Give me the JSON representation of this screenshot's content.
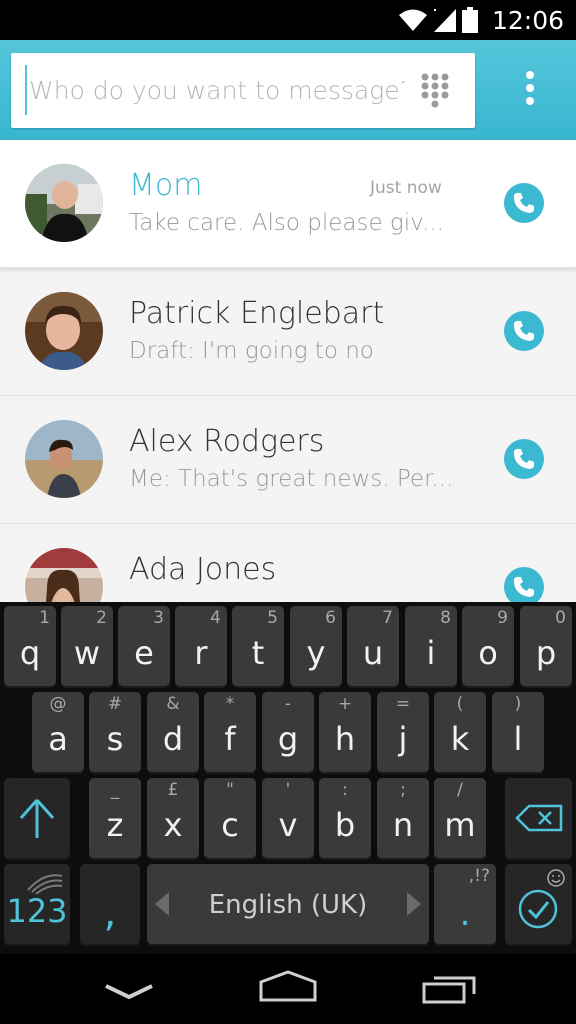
{
  "status_bar": {
    "time": "12:06"
  },
  "search": {
    "placeholder": "Who do you want to message?",
    "value": ""
  },
  "conversations": [
    {
      "name": "Mom",
      "snippet": "Take care. Also please giv...",
      "time": "Just now",
      "selected": true
    },
    {
      "name": "Patrick Englebart",
      "snippet": "Draft: I'm going to no",
      "time": ""
    },
    {
      "name": "Alex Rodgers",
      "snippet": "Me: That's great news.  Per...",
      "time": ""
    },
    {
      "name": "Ada Jones",
      "snippet": "",
      "time": ""
    }
  ],
  "keyboard": {
    "row1": [
      {
        "k": "q",
        "s": "1"
      },
      {
        "k": "w",
        "s": "2"
      },
      {
        "k": "e",
        "s": "3"
      },
      {
        "k": "r",
        "s": "4"
      },
      {
        "k": "t",
        "s": "5"
      },
      {
        "k": "y",
        "s": "6"
      },
      {
        "k": "u",
        "s": "7"
      },
      {
        "k": "i",
        "s": "8"
      },
      {
        "k": "o",
        "s": "9"
      },
      {
        "k": "p",
        "s": "0"
      }
    ],
    "row2": [
      {
        "k": "a",
        "s": "@"
      },
      {
        "k": "s",
        "s": "#"
      },
      {
        "k": "d",
        "s": "&"
      },
      {
        "k": "f",
        "s": "*"
      },
      {
        "k": "g",
        "s": "-"
      },
      {
        "k": "h",
        "s": "+"
      },
      {
        "k": "j",
        "s": "="
      },
      {
        "k": "k",
        "s": "("
      },
      {
        "k": "l",
        "s": ")"
      }
    ],
    "row3": [
      {
        "k": "z",
        "s": "_"
      },
      {
        "k": "x",
        "s": "£"
      },
      {
        "k": "c",
        "s": "\""
      },
      {
        "k": "v",
        "s": "'"
      },
      {
        "k": "b",
        "s": ":"
      },
      {
        "k": "n",
        "s": ";"
      },
      {
        "k": "m",
        "s": "/"
      }
    ],
    "numbers_label": "123",
    "comma_label": ",",
    "space_label": "English (UK)",
    "period_label": ".",
    "period_sub": ",!?"
  },
  "colors": {
    "accent": "#3bb8d0",
    "appbar": "#4cc0d8",
    "keyboard_bg": "#0d0d0d",
    "key_bg": "#3a3a3a"
  }
}
